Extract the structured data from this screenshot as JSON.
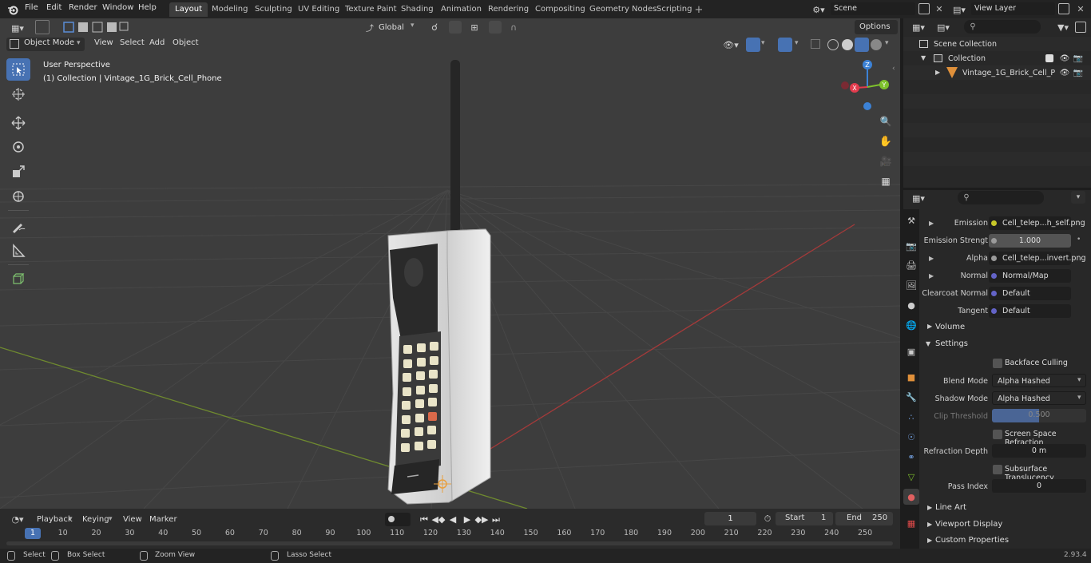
{
  "menu": [
    "File",
    "Edit",
    "Render",
    "Window",
    "Help"
  ],
  "workspaces": [
    "Layout",
    "Modeling",
    "Sculpting",
    "UV Editing",
    "Texture Paint",
    "Shading",
    "Animation",
    "Rendering",
    "Compositing",
    "Geometry Nodes",
    "Scripting"
  ],
  "active_workspace": "Layout",
  "scene_name": "Scene",
  "view_layer": "View Layer",
  "viewport": {
    "mode": "Object Mode",
    "menus": [
      "View",
      "Select",
      "Add",
      "Object"
    ],
    "orientation": "Global",
    "options_label": "Options",
    "overlay_line1": "User Perspective",
    "overlay_line2": "(1) Collection | Vintage_1G_Brick_Cell_Phone",
    "gizmo": {
      "x": "X",
      "y": "Y",
      "z": "Z"
    }
  },
  "outliner": {
    "scene_collection": "Scene Collection",
    "collection": "Collection",
    "object": "Vintage_1G_Brick_Cell_P"
  },
  "properties": {
    "rows": [
      {
        "label": "Emission",
        "value": "Cell_telep...h_self.png",
        "socket": "#c7c729",
        "expand": true
      },
      {
        "label": "Emission Strengt",
        "value": "1.000",
        "socket": "#9a9a9a",
        "slider": true
      },
      {
        "label": "Alpha",
        "value": "Cell_telep...invert.png",
        "socket": "#9a9a9a",
        "expand": true
      },
      {
        "label": "Normal",
        "value": "Normal/Map",
        "socket": "#6363c7",
        "expand": true
      },
      {
        "label": "Clearcoat Normal",
        "value": "Default",
        "socket": "#6363c7"
      },
      {
        "label": "Tangent",
        "value": "Default",
        "socket": "#6363c7"
      }
    ],
    "volume": "Volume",
    "settings": "Settings",
    "backface_culling": "Backface Culling",
    "blend_mode_label": "Blend Mode",
    "blend_mode": "Alpha Hashed",
    "shadow_mode_label": "Shadow Mode",
    "shadow_mode": "Alpha Hashed",
    "clip_threshold_label": "Clip Threshold",
    "clip_threshold": "0.500",
    "screen_space_refraction": "Screen Space Refraction",
    "refraction_depth_label": "Refraction Depth",
    "refraction_depth": "0 m",
    "subsurface_translucency": "Subsurface Translucency",
    "pass_index_label": "Pass Index",
    "pass_index": "0",
    "line_art": "Line Art",
    "viewport_display": "Viewport Display",
    "custom_properties": "Custom Properties"
  },
  "timeline": {
    "menus": [
      "Playback",
      "Keying",
      "View",
      "Marker"
    ],
    "current_frame": "1",
    "start_label": "Start",
    "start": "1",
    "end_label": "End",
    "end": "250",
    "ruler": [
      "1",
      "10",
      "20",
      "30",
      "40",
      "50",
      "60",
      "70",
      "80",
      "90",
      "100",
      "110",
      "120",
      "130",
      "140",
      "150",
      "160",
      "170",
      "180",
      "190",
      "200",
      "210",
      "220",
      "230",
      "240",
      "250"
    ]
  },
  "status": {
    "select": "Select",
    "box_select": "Box Select",
    "zoom_view": "Zoom View",
    "lasso_select": "Lasso Select",
    "version": "2.93.4"
  },
  "colors": {
    "accent": "#4772b3",
    "x_axis": "#e23b4d",
    "y_axis": "#7ec12c",
    "z_axis": "#3c82d6"
  }
}
